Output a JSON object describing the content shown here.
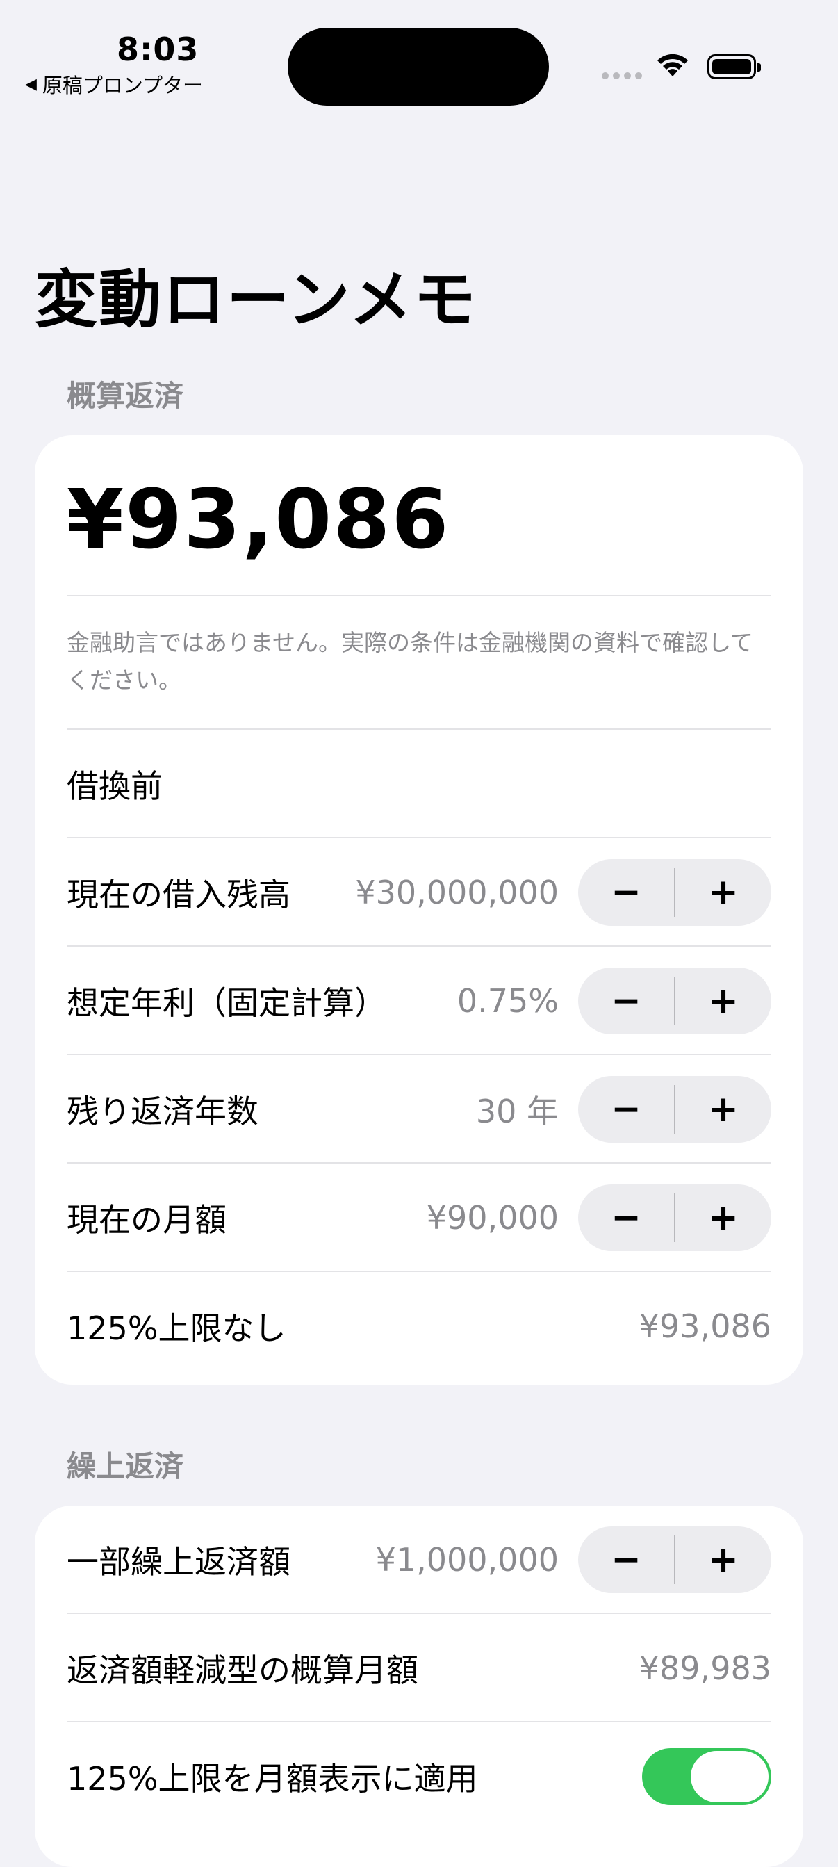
{
  "status_bar": {
    "time": "8:03",
    "back_label": "原稿プロンプター"
  },
  "page_title": "変動ローンメモ",
  "summary_section": {
    "label": "概算返済",
    "amount": "¥93,086",
    "disclaimer": "金融助言ではありません。実際の条件は金融機関の資料で確認してください。",
    "subheading": "借換前",
    "rows": [
      {
        "label": "現在の借入残高",
        "value": "¥30,000,000"
      },
      {
        "label": "想定年利（固定計算）",
        "value": "0.75%"
      },
      {
        "label": "残り返済年数",
        "value": "30 年"
      },
      {
        "label": "現在の月額",
        "value": "¥90,000"
      }
    ],
    "no_cap": {
      "label": "125%上限なし",
      "value": "¥93,086"
    }
  },
  "prepay_section": {
    "label": "繰上返済",
    "partial": {
      "label": "一部繰上返済額",
      "value": "¥1,000,000"
    },
    "reduced": {
      "label": "返済額軽減型の概算月額",
      "value": "¥89,983"
    },
    "cap_toggle": {
      "label": "125%上限を月額表示に適用",
      "on": true
    }
  },
  "stepper": {
    "minus": "−",
    "plus": "+"
  },
  "colors": {
    "toggle_on": "#34c759",
    "background": "#f2f2f7",
    "secondary_text": "#8a8a8e"
  }
}
